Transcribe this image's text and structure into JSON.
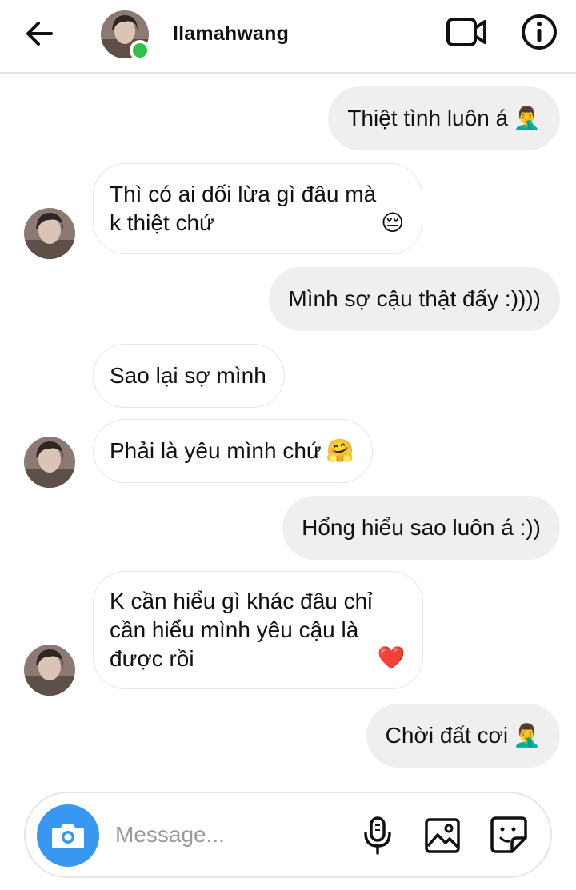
{
  "header": {
    "username": "llamahwang",
    "back_icon": "arrow-left-icon",
    "video_icon": "video-call-icon",
    "info_icon": "info-icon",
    "status_color": "#2ec24b"
  },
  "messages": [
    {
      "side": "out",
      "text": "Thiệt tình luôn á",
      "emoji": "🤦‍♂️"
    },
    {
      "side": "in",
      "text": "Thì có ai dối lừa gì đâu mà\nk thiệt chứ",
      "emoji": "😔"
    },
    {
      "side": "out",
      "text": "Mình sợ cậu thật đấy :))))",
      "emoji": ""
    },
    {
      "side": "in",
      "text": "Sao lại sợ mình",
      "emoji": ""
    },
    {
      "side": "in",
      "text": "Phải là yêu mình chứ",
      "emoji": "🤗"
    },
    {
      "side": "out",
      "text": "Hổng hiểu sao luôn á :))",
      "emoji": ""
    },
    {
      "side": "in",
      "text": "K cần hiểu gì khác đâu chỉ\ncần hiểu mình yêu cậu là\nđược rồi",
      "emoji": "❤️"
    },
    {
      "side": "out",
      "text": "Chời đất cơi",
      "emoji": "🤦‍♂️"
    }
  ],
  "composer": {
    "placeholder": "Message...",
    "camera_icon": "camera-icon",
    "mic_icon": "microphone-icon",
    "gallery_icon": "image-gallery-icon",
    "sticker_icon": "sticker-icon",
    "accent_color": "#3897f0"
  }
}
